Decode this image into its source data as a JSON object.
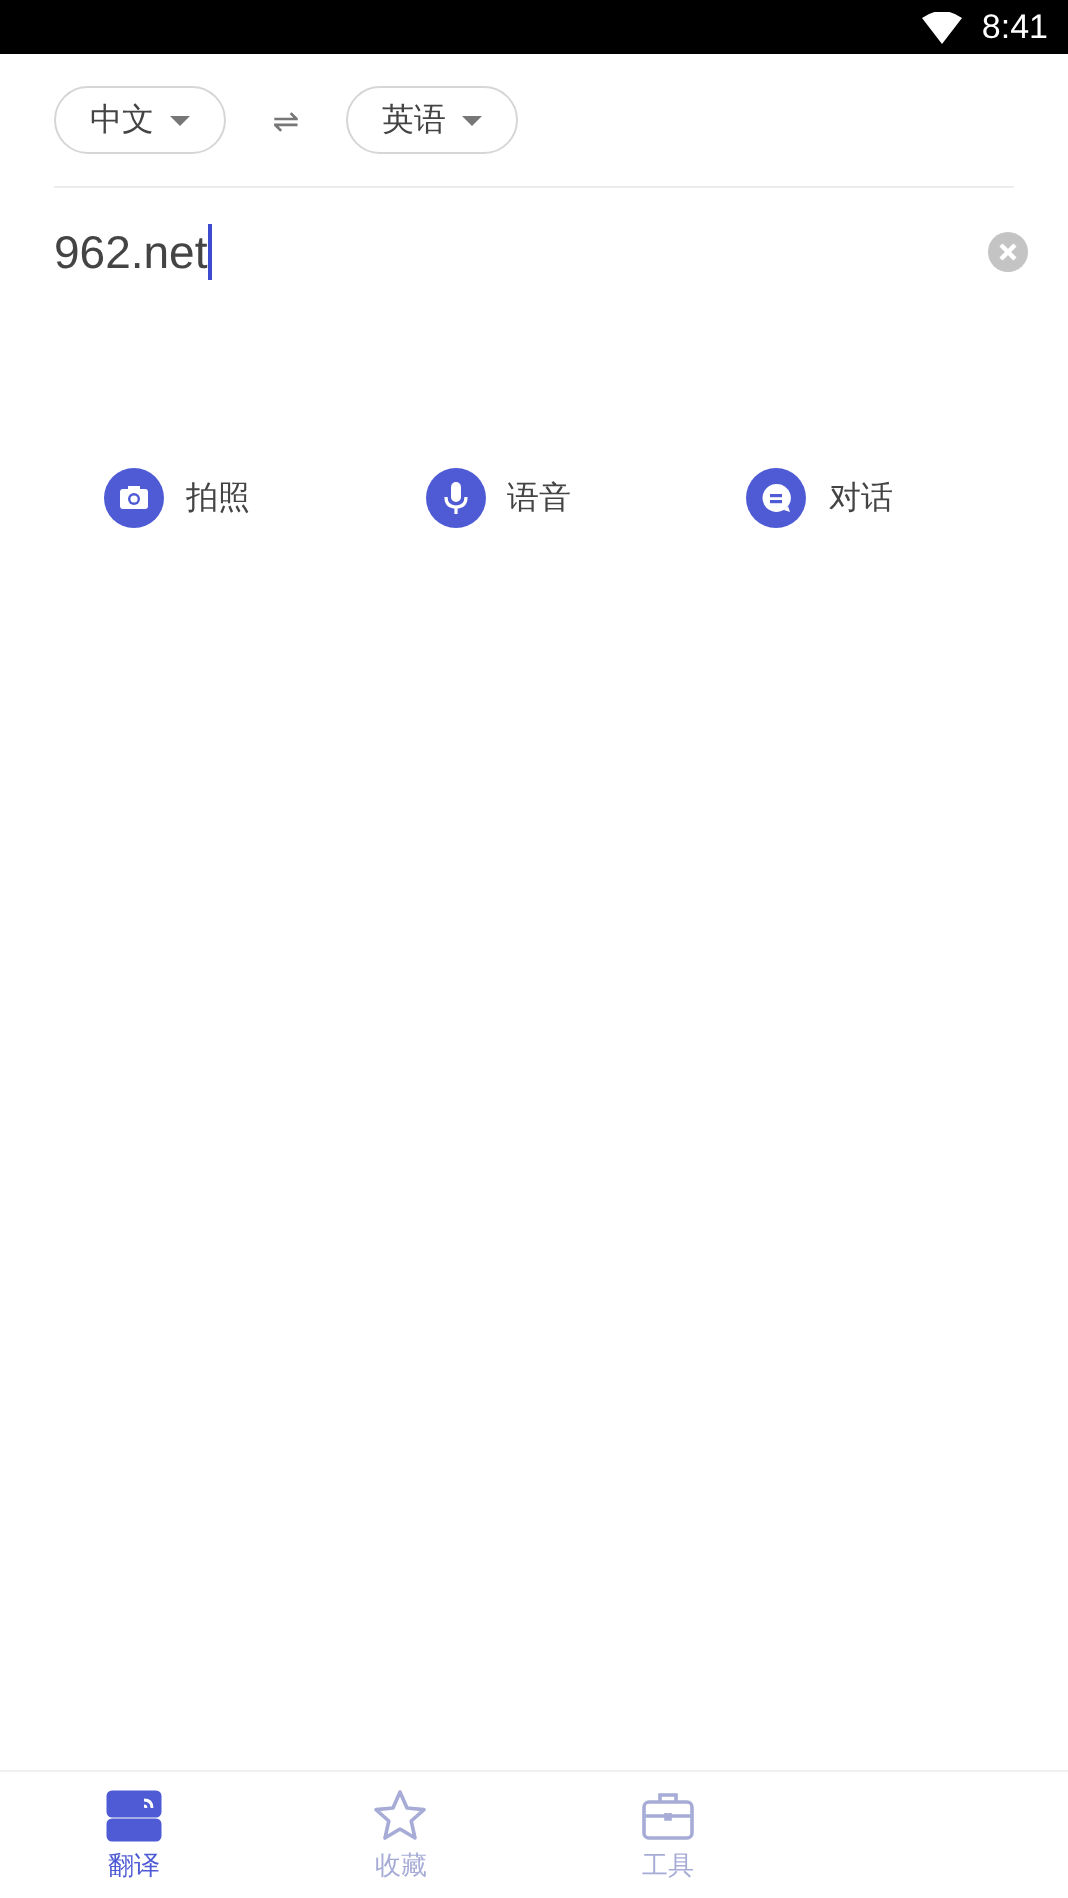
{
  "status_bar": {
    "time": "8:41"
  },
  "languages": {
    "source": "中文",
    "target": "英语",
    "swap": "⇌"
  },
  "input": {
    "value": "962.net",
    "focused": true
  },
  "actions": [
    {
      "kind": "camera",
      "label": "拍照"
    },
    {
      "kind": "mic",
      "label": "语音"
    },
    {
      "kind": "chat",
      "label": "对话"
    }
  ],
  "tabs": [
    {
      "kind": "translate",
      "label": "翻译",
      "selected": true
    },
    {
      "kind": "star",
      "label": "收藏",
      "selected": false
    },
    {
      "kind": "tools",
      "label": "工具",
      "selected": false
    }
  ]
}
